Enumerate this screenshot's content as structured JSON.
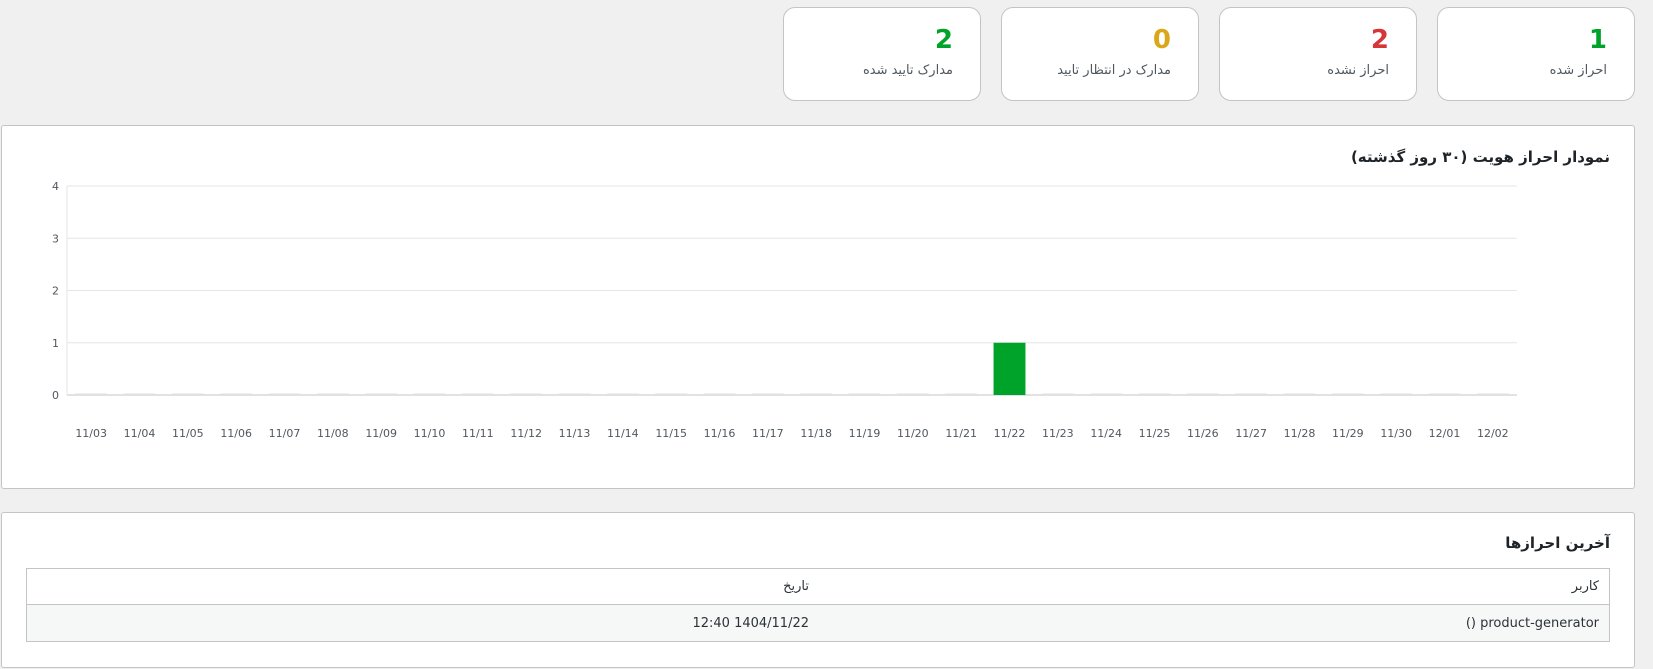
{
  "stats": [
    {
      "value": "1",
      "label": "احراز شده",
      "color": "#00a32a"
    },
    {
      "value": "2",
      "label": "احراز نشده",
      "color": "#d63638"
    },
    {
      "value": "0",
      "label": "مدارک در انتظار تایید",
      "color": "#dba617"
    },
    {
      "value": "2",
      "label": "مدارک تایید شده",
      "color": "#00a32a"
    }
  ],
  "chart_panel": {
    "title": "نمودار احراز هویت (۳۰ روز گذشته)"
  },
  "chart_data": {
    "type": "bar",
    "title": "نمودار احراز هویت (۳۰ روز گذشته)",
    "categories": [
      "11/03",
      "11/04",
      "11/05",
      "11/06",
      "11/07",
      "11/08",
      "11/09",
      "11/10",
      "11/11",
      "11/12",
      "11/13",
      "11/14",
      "11/15",
      "11/16",
      "11/17",
      "11/18",
      "11/19",
      "11/20",
      "11/21",
      "11/22",
      "11/23",
      "11/24",
      "11/25",
      "11/26",
      "11/27",
      "11/28",
      "11/29",
      "11/30",
      "12/01",
      "12/02"
    ],
    "values": [
      0,
      0,
      0,
      0,
      0,
      0,
      0,
      0,
      0,
      0,
      0,
      0,
      0,
      0,
      0,
      0,
      0,
      0,
      0,
      1,
      0,
      0,
      0,
      0,
      0,
      0,
      0,
      0,
      0,
      0
    ],
    "ylim": [
      0,
      4
    ],
    "yticks": [
      "0",
      "1",
      "2",
      "3",
      "4"
    ],
    "bar_color": "#00a32a",
    "grid": true
  },
  "table_panel": {
    "title": "آخرین احرازها",
    "headers": {
      "user": "کاربر",
      "date": "تاریخ"
    },
    "rows": [
      {
        "user": "product-generator ()",
        "date": "1404/11/22 12:40"
      }
    ]
  }
}
